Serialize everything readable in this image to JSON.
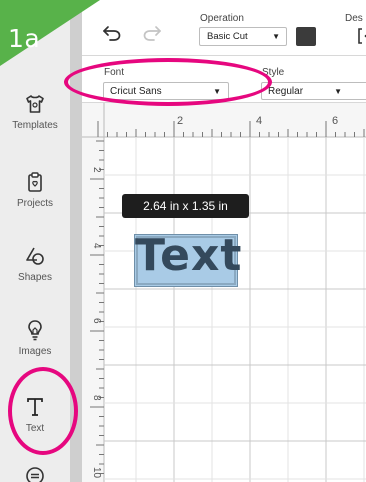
{
  "step": {
    "label": "1a",
    "color": "#58b24a"
  },
  "sidebar": {
    "items": [
      {
        "label": "Templates",
        "icon": "shirt-icon"
      },
      {
        "label": "Projects",
        "icon": "clipboard-icon"
      },
      {
        "label": "Shapes",
        "icon": "shapes-icon"
      },
      {
        "label": "Images",
        "icon": "lightbulb-icon"
      },
      {
        "label": "Text",
        "icon": "text-t-icon"
      },
      {
        "label": "",
        "icon": "more-icon"
      }
    ]
  },
  "toolbar": {
    "operation_label": "Operation",
    "operation_value": "Basic Cut",
    "swatch_color": "#3b3b3b",
    "des_label": "Des"
  },
  "fontbar": {
    "font_label": "Font",
    "font_value": "Cricut Sans",
    "style_label": "Style",
    "style_value": "Regular"
  },
  "ruler": {
    "horizontal_numbers": [
      "2",
      "4",
      "6"
    ],
    "vertical_numbers": [
      "2",
      "4",
      "6",
      "8",
      "10"
    ]
  },
  "canvas": {
    "dimension_tooltip": "2.64  in x 1.35  in",
    "text_object": "Text",
    "text_fill": "#a9cbe6"
  },
  "highlight_color": "#e6077f"
}
